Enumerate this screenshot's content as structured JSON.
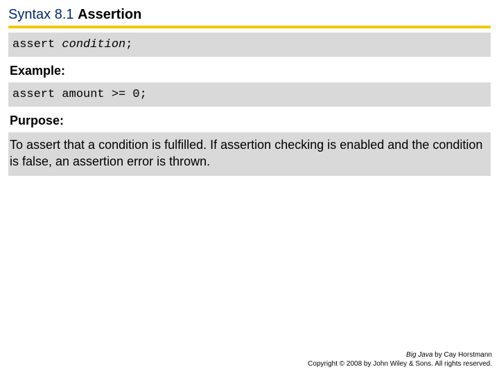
{
  "title": {
    "prefix": "Syntax 8.1",
    "suffix": "Assertion"
  },
  "syntax_code": {
    "keyword": "assert ",
    "condition": "condition",
    "terminator": ";"
  },
  "labels": {
    "example": "Example:",
    "purpose": "Purpose:"
  },
  "example_code": "assert amount >= 0;",
  "purpose_text": "To assert that a condition is fulfilled. If assertion checking is enabled and the condition is false, an assertion error is thrown.",
  "footer": {
    "book": "Big Java",
    "author": " by Cay Horstmann",
    "copyright": "Copyright © 2008 by John Wiley & Sons. All rights reserved."
  }
}
